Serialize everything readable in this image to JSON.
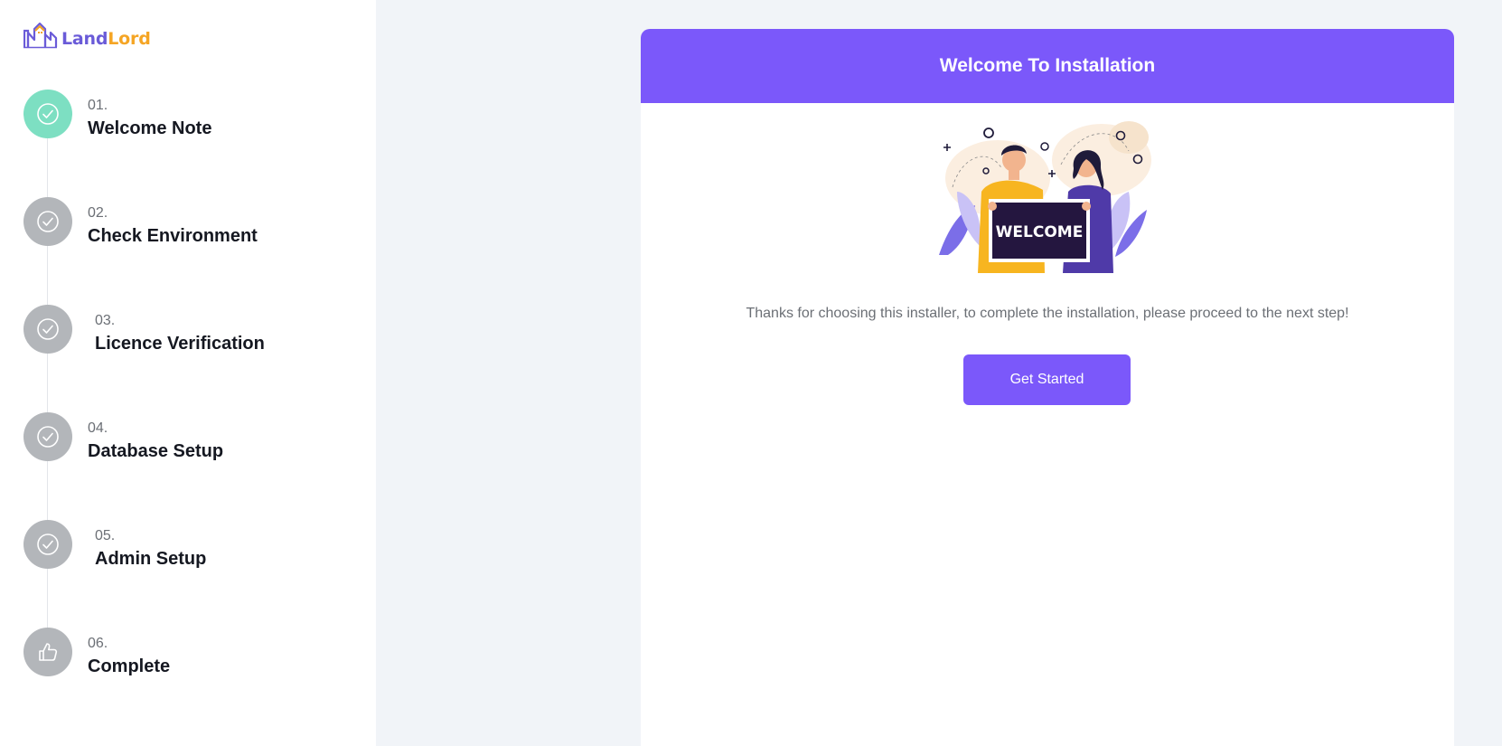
{
  "brand": {
    "part1": "Land",
    "part2": "Lord"
  },
  "steps": [
    {
      "number": "01.",
      "title": "Welcome Note",
      "icon": "check-circle-icon",
      "active": true
    },
    {
      "number": "02.",
      "title": "Check Environment",
      "icon": "check-circle-icon",
      "active": false
    },
    {
      "number": "03.",
      "title": "Licence Verification",
      "icon": "check-circle-icon",
      "active": false
    },
    {
      "number": "04.",
      "title": "Database Setup",
      "icon": "check-circle-icon",
      "active": false
    },
    {
      "number": "05.",
      "title": "Admin Setup",
      "icon": "check-circle-icon",
      "active": false
    },
    {
      "number": "06.",
      "title": "Complete",
      "icon": "thumbs-up-icon",
      "active": false
    }
  ],
  "card": {
    "title": "Welcome To Installation",
    "illustration_sign": "WELCOME",
    "message": "Thanks for choosing this installer, to complete the installation, please proceed to the next step!",
    "button_label": "Get Started"
  },
  "colors": {
    "accent": "#7b58fa",
    "step_active": "#7ddfc2",
    "step_inactive": "#b3b6ba",
    "brand_land": "#6a5bd8",
    "brand_lord": "#f5a524"
  }
}
